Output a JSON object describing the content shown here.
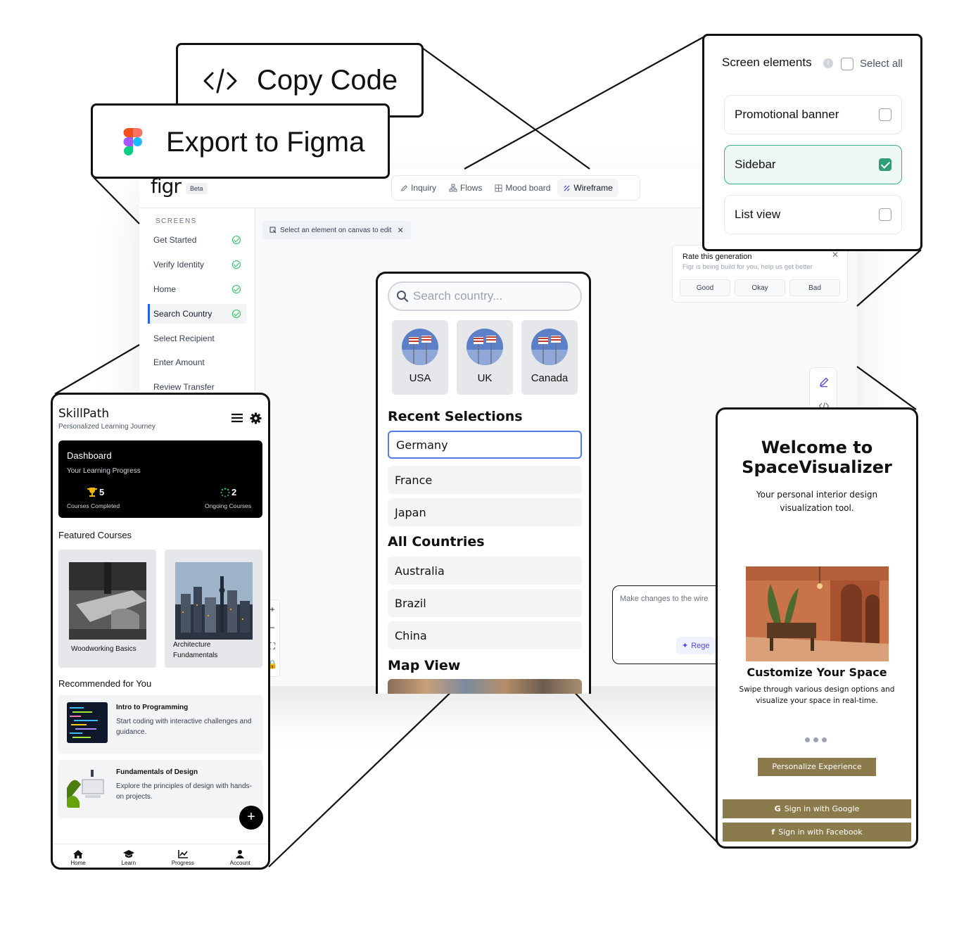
{
  "floating_actions": {
    "copy_code": "Copy Code",
    "export_figma": "Export to Figma"
  },
  "app": {
    "logo": "figr",
    "beta": "Beta",
    "modes": [
      {
        "label": "Inquiry",
        "icon": "pen-icon"
      },
      {
        "label": "Flows",
        "icon": "flow-icon"
      },
      {
        "label": "Mood board",
        "icon": "grid-icon"
      },
      {
        "label": "Wireframe",
        "icon": "wireframe-icon",
        "active": true
      }
    ],
    "sidebar": {
      "title": "SCREENS",
      "items": [
        {
          "label": "Get Started",
          "done": true
        },
        {
          "label": "Verify Identity",
          "done": true
        },
        {
          "label": "Home",
          "done": true
        },
        {
          "label": "Search Country",
          "done": true,
          "active": true
        },
        {
          "label": "Select Recipient",
          "done": false
        },
        {
          "label": "Enter Amount",
          "done": false
        },
        {
          "label": "Review Transfer",
          "done": false
        }
      ]
    },
    "edit_hint": "Select an element on canvas to edit",
    "rating": {
      "title": "Rate this generation",
      "subtitle": "Figr is being build for you, help us get better",
      "options": [
        "Good",
        "Okay",
        "Bad"
      ]
    },
    "prompt": {
      "placeholder": "Make changes to the wire",
      "button": "Rege"
    }
  },
  "screen_elements": {
    "title": "Screen elements",
    "select_all": "Select all",
    "options": [
      {
        "label": "Promotional banner",
        "checked": false
      },
      {
        "label": "Sidebar",
        "checked": true
      },
      {
        "label": "List view",
        "checked": false
      }
    ]
  },
  "search_country": {
    "placeholder": "Search country...",
    "countries": [
      "USA",
      "UK",
      "Canada"
    ],
    "recent_title": "Recent Selections",
    "recent": [
      "Germany",
      "France",
      "Japan"
    ],
    "all_title": "All Countries",
    "all": [
      "Australia",
      "Brazil",
      "China"
    ],
    "map_title": "Map View"
  },
  "skillpath": {
    "title": "SkillPath",
    "subtitle": "Personalized Learning Journey",
    "dashboard": {
      "title": "Dashboard",
      "subtitle": "Your Learning Progress",
      "completed_value": "5",
      "completed_label": "Courses Completed",
      "ongoing_value": "2",
      "ongoing_label": "Ongoing Courses"
    },
    "featured_title": "Featured Courses",
    "featured": [
      {
        "title": "Woodworking Basics"
      },
      {
        "title_line1": "Architecture",
        "title_line2": "Fundamentals"
      }
    ],
    "recommended_title": "Recommended for You",
    "recommended": [
      {
        "title": "Intro to Programming",
        "desc": "Start coding with interactive challenges and guidance."
      },
      {
        "title": "Fundamentals of Design",
        "desc": "Explore the principles of design with hands-on projects."
      }
    ],
    "nav": [
      "Home",
      "Learn",
      "Progress",
      "Account"
    ]
  },
  "space_visualizer": {
    "title_line1": "Welcome to",
    "title_line2": "SpaceVisualizer",
    "subtitle": "Your personal interior design visualization tool.",
    "heading": "Customize Your Space",
    "description": "Swipe through various design options and visualize your space in real-time.",
    "cta": "Personalize Experience",
    "google": "Sign in with Google",
    "facebook": "Sign in with Facebook"
  }
}
